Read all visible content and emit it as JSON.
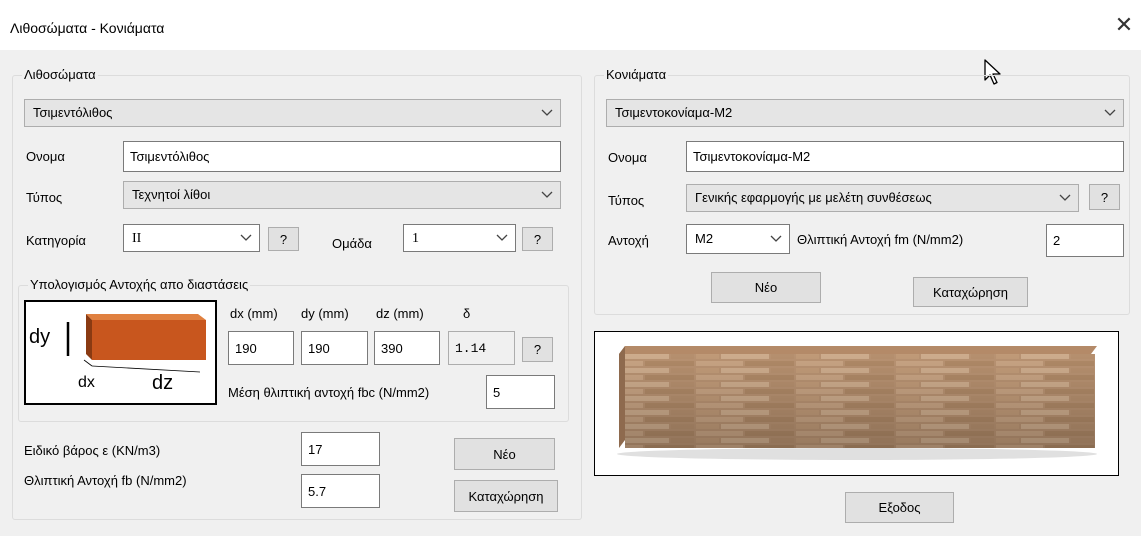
{
  "window": {
    "title": "Λιθοσώματα - Κονιάματα",
    "close_glyph": "✕"
  },
  "lithosomata": {
    "group_title": "Λιθοσώματα",
    "selected": "Τσιμεντόλιθος",
    "name_label": "Ονομα",
    "name_value": "Τσιμεντόλιθος",
    "type_label": "Τύπος",
    "type_value": "Τεχνητοί λίθοι",
    "category_label": "Κατηγορία",
    "category_value": "II",
    "group_label": "Ομάδα",
    "group_value": "1",
    "help": "?"
  },
  "strength_calc": {
    "group_title": "Υπολογισμός Αντοχής απο διαστάσεις",
    "dx_label": "dx (mm)",
    "dy_label": "dy (mm)",
    "dz_label": "dz (mm)",
    "delta_label": "δ",
    "dx": "190",
    "dy": "190",
    "dz": "390",
    "delta": "1.14",
    "help": "?",
    "fbc_label": "Μέση θλιπτική αντοχή fbc (N/mm2)",
    "fbc": "5",
    "diagram": {
      "dy": "dy",
      "dx": "dx",
      "dz": "dz",
      "brick_color": "#c8561e"
    }
  },
  "bottom_left": {
    "weight_label": "Ειδικό βάρος ε (KN/m3)",
    "weight": "17",
    "fb_label": "Θλιπτική Αντοχή fb (N/mm2)",
    "fb": "5.7",
    "new_button": "Νέο",
    "save_button": "Καταχώρηση"
  },
  "mortars": {
    "group_title": "Κονιάματα",
    "selected": "Τσιμεντοκονίαμα-M2",
    "name_label": "Ονομα",
    "name_value": "Τσιμεντοκονίαμα-M2",
    "type_label": "Τύπος",
    "type_value": "Γενικής εφαρμογής με μελέτη συνθέσεως",
    "help": "?",
    "strength_label": "Αντοχή",
    "strength_value": "M2",
    "fm_label": "Θλιπτική Αντοχή fm (N/mm2)",
    "fm": "2",
    "new_button": "Νέο",
    "save_button": "Καταχώρηση"
  },
  "exit_button": "Εξοδος",
  "icons": {
    "dropdown": "chevron-down-icon",
    "cursor": "mouse-cursor-icon",
    "close": "close-icon"
  }
}
